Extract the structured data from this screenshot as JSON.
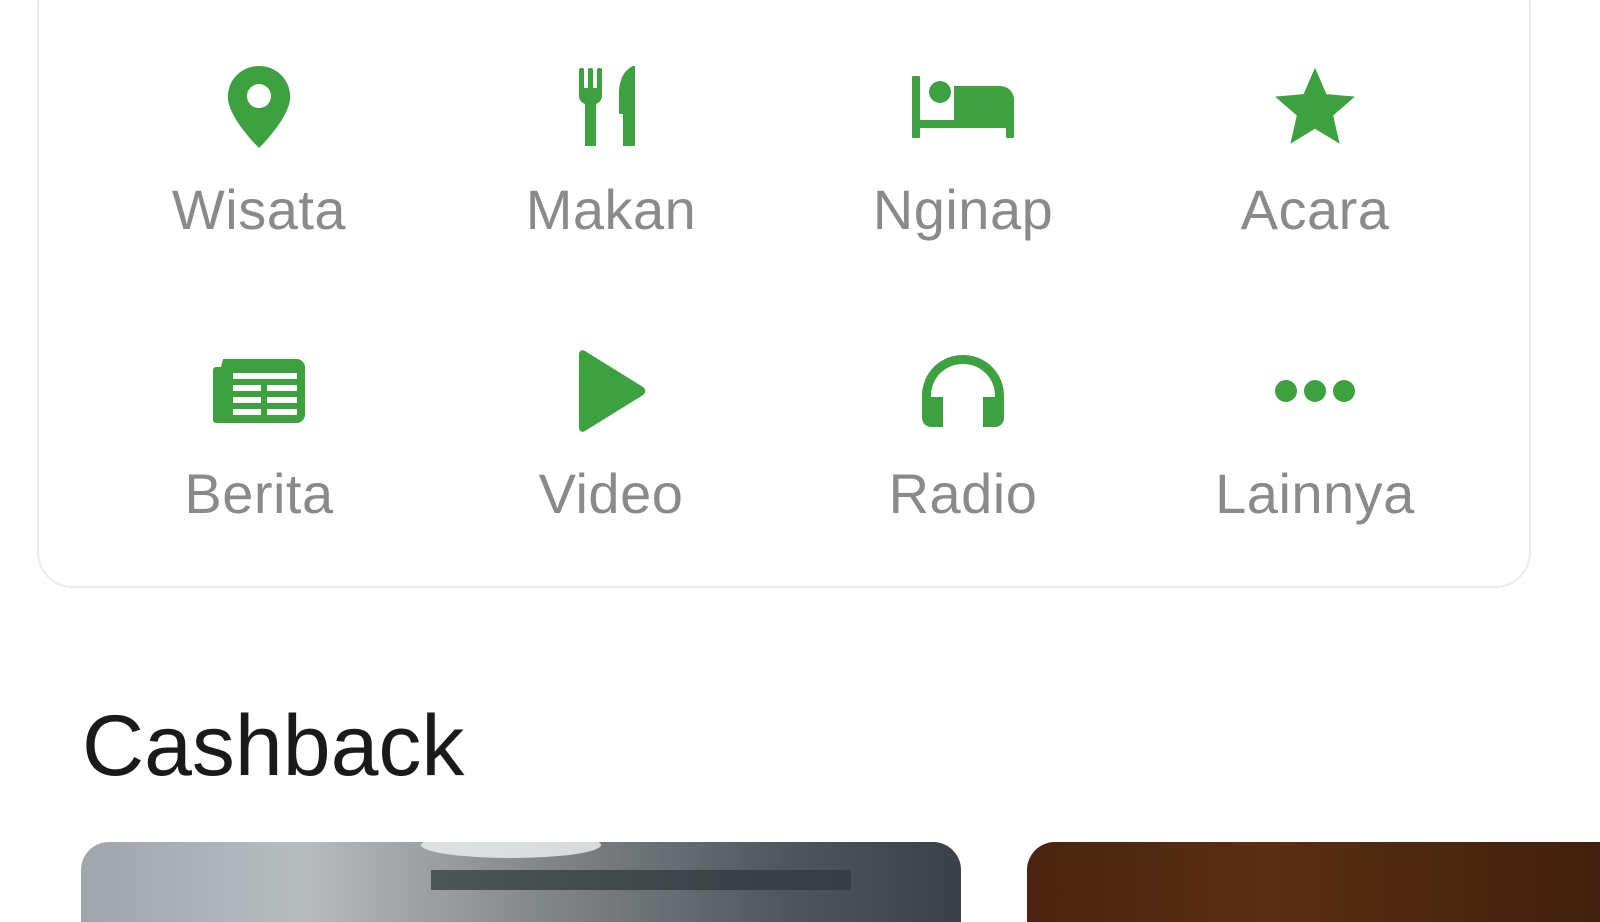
{
  "accent_color": "#3da13f",
  "menu": {
    "items": [
      {
        "label": "Wisata",
        "icon": "location-pin-icon"
      },
      {
        "label": "Makan",
        "icon": "restaurant-icon"
      },
      {
        "label": "Nginap",
        "icon": "hotel-bed-icon"
      },
      {
        "label": "Acara",
        "icon": "star-icon"
      },
      {
        "label": "Berita",
        "icon": "newspaper-icon"
      },
      {
        "label": "Video",
        "icon": "play-icon"
      },
      {
        "label": "Radio",
        "icon": "headphones-icon"
      },
      {
        "label": "Lainnya",
        "icon": "more-dots-icon"
      }
    ]
  },
  "cashback": {
    "title": "Cashback"
  }
}
